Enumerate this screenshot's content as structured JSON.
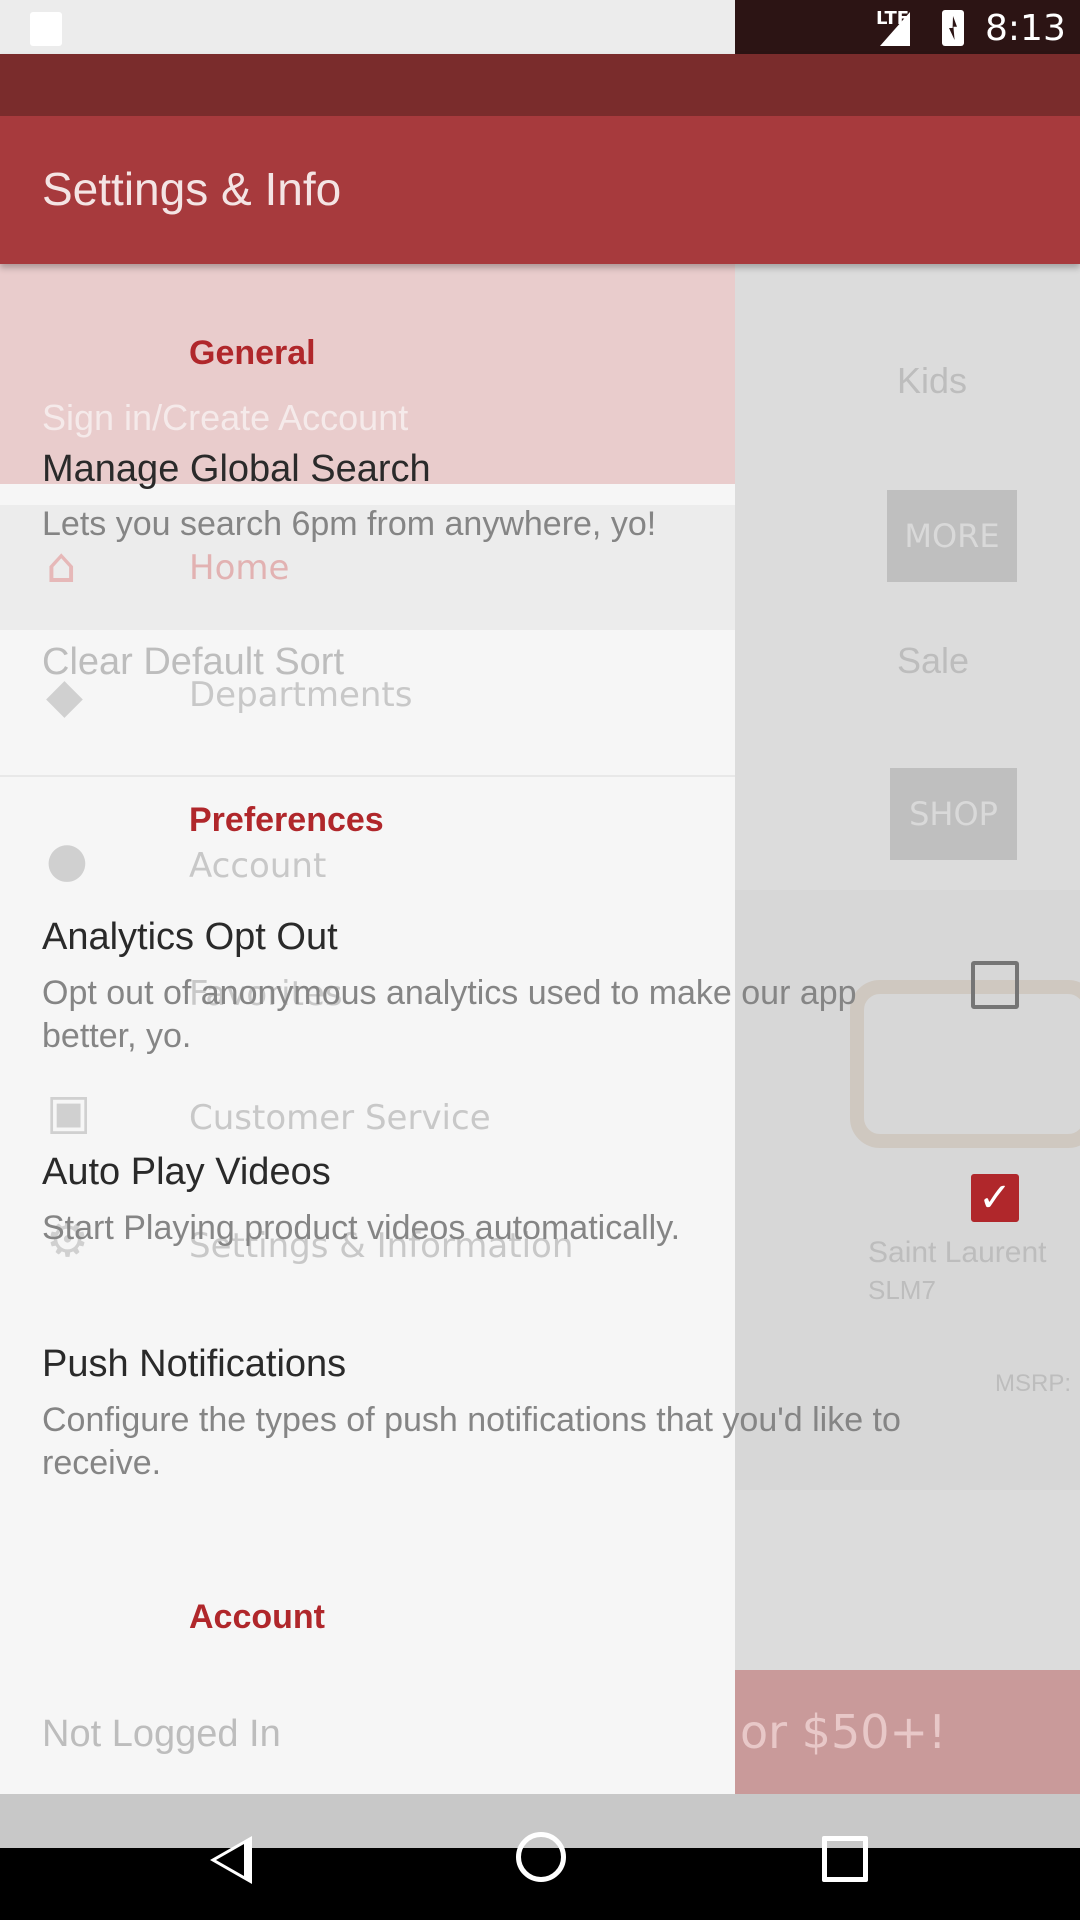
{
  "status_bar": {
    "network": "LTE",
    "time": "8:13",
    "icons": [
      "sd-card-icon",
      "signal-icon",
      "battery-charging-icon"
    ]
  },
  "background_app": {
    "categories": [
      "Kids",
      "Sale"
    ],
    "buttons": [
      "MORE",
      "SHOP"
    ],
    "product": {
      "brand": "Saint Laurent",
      "model": "SLM7",
      "price_label": "MSRP:"
    },
    "promo": "or $50+!"
  },
  "drawer_ghost": {
    "items": [
      "Home",
      "Departments",
      "Account",
      "Favorites",
      "Customer Service",
      "Settings & Information"
    ]
  },
  "settings": {
    "title": "Settings & Info",
    "sections": [
      {
        "category": "General",
        "items": [
          {
            "title": "Sign in/Create Account"
          },
          {
            "title": "Manage Global Search",
            "summary": "Lets you search 6pm from anywhere, yo!"
          },
          {
            "title": "Clear Default Sort"
          }
        ]
      },
      {
        "category": "Preferences",
        "items": [
          {
            "title": "Analytics Opt Out",
            "summary": "Opt out of anonymous analytics used to make our app better, yo.",
            "checked": false
          },
          {
            "title": "Auto Play Videos",
            "summary": "Start Playing product videos automatically.",
            "checked": true
          },
          {
            "title": "Push Notifications",
            "summary": "Configure the types of push notifications that you'd like to receive."
          }
        ]
      },
      {
        "category": "Account",
        "items": [
          {
            "title": "Not Logged In"
          }
        ]
      }
    ]
  },
  "nav_bar": {
    "buttons": [
      "back",
      "home",
      "recents"
    ]
  },
  "colors": {
    "primary": "#a73a3d",
    "accent": "#b0272b"
  }
}
